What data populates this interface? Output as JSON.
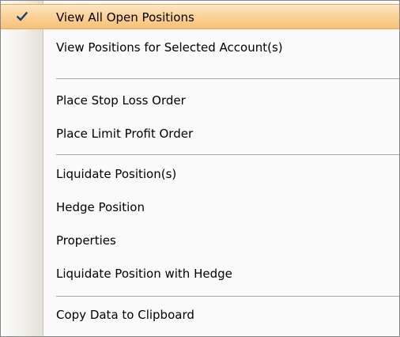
{
  "menu": {
    "items": [
      {
        "label": "View All Open Positions",
        "checked": true,
        "highlighted": true
      },
      {
        "label": "View Positions for Selected Account(s)"
      },
      {
        "label": "Place Stop Loss Order"
      },
      {
        "label": "Place Limit Profit Order"
      },
      {
        "label": "Liquidate Position(s)"
      },
      {
        "label": "Hedge Position"
      },
      {
        "label": "Properties"
      },
      {
        "label": "Liquidate Position with Hedge"
      },
      {
        "label": "Copy Data to Clipboard"
      }
    ],
    "check_icon": "checkmark-icon",
    "colors": {
      "highlight": "#fbd49a",
      "highlight_border": "#e9a95a",
      "check": "#1f3f6f"
    }
  }
}
